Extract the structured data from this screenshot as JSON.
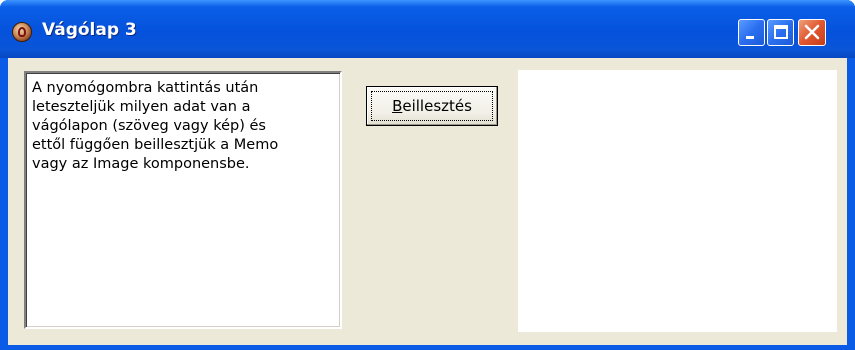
{
  "window": {
    "title": "Vágólap 3",
    "accent_color": "#0a5ce6",
    "client_color": "#ece9d8",
    "caption_buttons": [
      "minimize-icon",
      "maximize-icon",
      "close-icon"
    ]
  },
  "memo": {
    "text": "A nyomógombra kattintás után\nleteszteljük milyen adat van a\nvágólapon (szöveg vagy kép) és\nettől függően beillesztjük a Memo\nvagy az Image komponensbe."
  },
  "paste_button": {
    "accel": "B",
    "rest": "eillesztés"
  },
  "image": {
    "content": ""
  }
}
